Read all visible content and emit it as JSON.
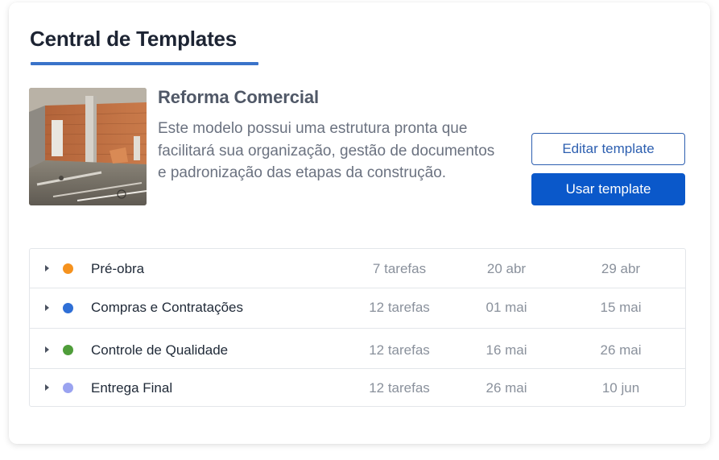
{
  "page": {
    "title": "Central de Templates"
  },
  "template": {
    "name": "Reforma Comercial",
    "description": "Este modelo possui uma estrutura pronta que facilitará sua organização, gestão de documentos e padronização das etapas da construção.",
    "thumbnail_icon": "construction-site-photo"
  },
  "actions": {
    "edit_label": "Editar template",
    "use_label": "Usar template"
  },
  "colors": {
    "accent": "#3a73c9",
    "primary_button": "#0a58ca"
  },
  "phases": [
    {
      "name": "Pré-obra",
      "tasks": "7 tarefas",
      "start": "20 abr",
      "end": "29 abr",
      "color": "#f5921e"
    },
    {
      "name": "Compras e Contratações",
      "tasks": "12 tarefas",
      "start": "01 mai",
      "end": "15 mai",
      "color": "#2f6fd6"
    },
    {
      "name": "Controle de Qualidade",
      "tasks": "12 tarefas",
      "start": "16 mai",
      "end": "26 mai",
      "color": "#4f9d3a"
    },
    {
      "name": "Entrega Final",
      "tasks": "12 tarefas",
      "start": "26 mai",
      "end": "10 jun",
      "color": "#9aa3f0"
    }
  ]
}
